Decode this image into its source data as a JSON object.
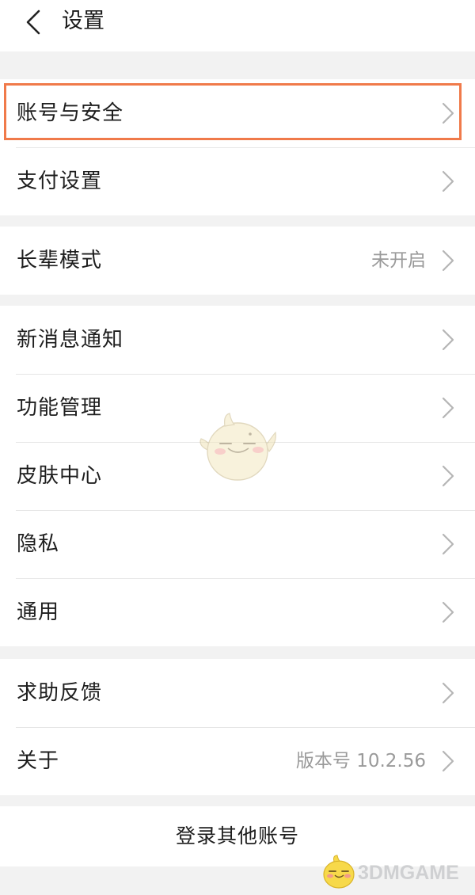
{
  "header": {
    "back_icon": "chevron-left-icon",
    "title": "设置"
  },
  "groups": [
    {
      "items": [
        {
          "label": "账号与安全",
          "value": ""
        },
        {
          "label": "支付设置",
          "value": ""
        }
      ]
    },
    {
      "items": [
        {
          "label": "长辈模式",
          "value": "未开启"
        }
      ]
    },
    {
      "items": [
        {
          "label": "新消息通知",
          "value": ""
        },
        {
          "label": "功能管理",
          "value": ""
        },
        {
          "label": "皮肤中心",
          "value": ""
        },
        {
          "label": "隐私",
          "value": ""
        },
        {
          "label": "通用",
          "value": ""
        }
      ]
    },
    {
      "items": [
        {
          "label": "求助反馈",
          "value": ""
        },
        {
          "label": "关于",
          "value": "版本号 10.2.56"
        }
      ]
    }
  ],
  "login_other": "登录其他账号",
  "highlight_color": "#f07a4a",
  "watermark": {
    "text": "3DMGAME",
    "icon": "bird-mascot-logo"
  }
}
